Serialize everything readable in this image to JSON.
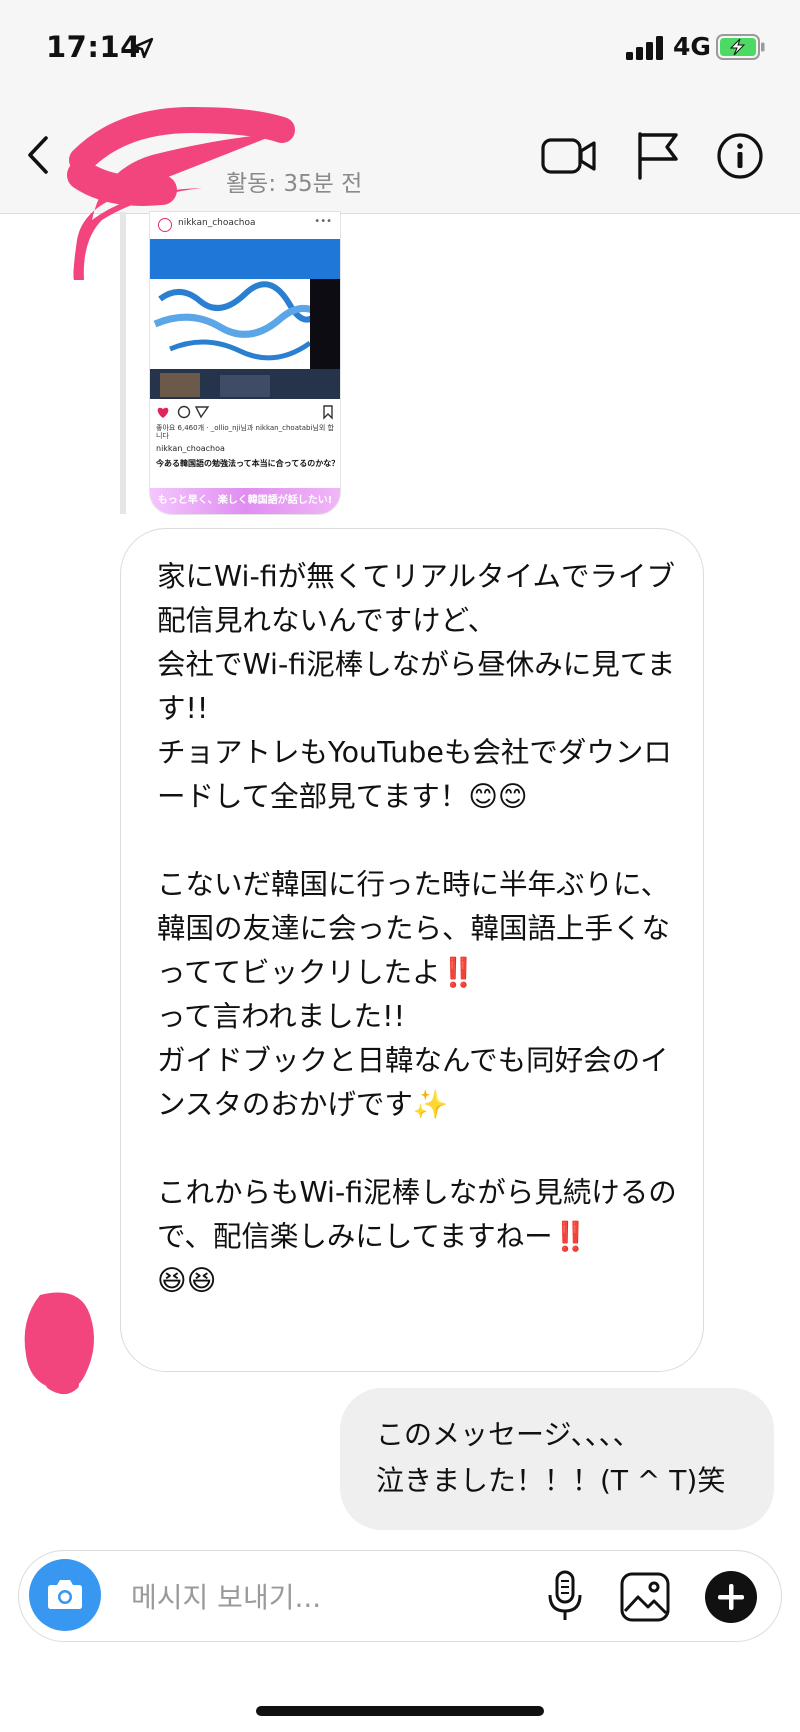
{
  "status_bar": {
    "time": "17:14",
    "network": "4G",
    "icons": [
      "location-arrow-icon",
      "cellular-signal-icon",
      "battery-charging-icon"
    ],
    "battery_color": "#4cd964"
  },
  "header": {
    "active_status": "활동: 35분 전",
    "icons": [
      "back-chevron-icon",
      "video-call-icon",
      "flag-icon",
      "info-icon"
    ]
  },
  "shared_post": {
    "username": "nikkan_choachoa",
    "likes_text": "좋아요 6,460개 · _ollio_nji님과 nikkan_choatabi님외 합니다",
    "owner": "nikkan_choachoa",
    "caption": "今ある韓国語の勉強法って本当に合ってるのかな？",
    "banner": "もっと早く、楽しく韓国語が話したい!"
  },
  "messages": [
    {
      "direction": "received",
      "text": "家にWi-fiが無くてリアルタイムでライブ配信見れないんですけど、\n会社でWi-fi泥棒しながら昼休みに見てます!!\nチョアトレもYouTubeも会社でダウンロードして全部見てます！😊😊\n\nこないだ韓国に行った時に半年ぶりに、韓国の友達に会ったら、韓国語上手くなっててビックリしたよ‼️\nって言われました!!\nガイドブックと日韓なんでも同好会のインスタのおかげです✨\n\nこれからもWi-fi泥棒しながら見続けるので、配信楽しみにしてますねー‼️\n😆😆"
    },
    {
      "direction": "sent",
      "text": "このメッセージ、、、、\n泣きました！！！(T ^ T)笑"
    }
  ],
  "composer": {
    "placeholder": "메시지 보내기...",
    "icons": [
      "camera-icon",
      "microphone-icon",
      "gallery-icon",
      "add-icon"
    ]
  },
  "colors": {
    "accent_blue": "#3897f0",
    "redaction_pink": "#f2457e",
    "bubble_sent_bg": "#efefef",
    "bubble_border": "#dbdbdb"
  }
}
